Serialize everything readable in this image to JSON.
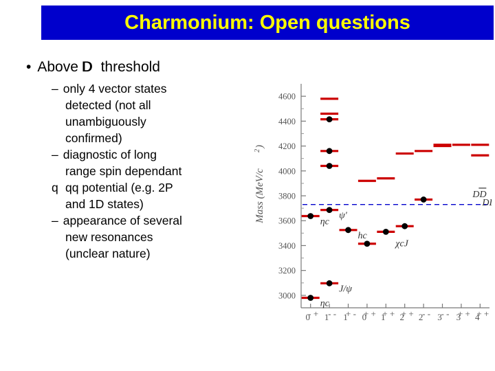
{
  "slide": {
    "title": "Charmonium: Open questions",
    "title_bg": "#0000CC",
    "title_color": "#FFFF00"
  },
  "content": {
    "bullet_glyph": "•",
    "dash_glyph": "–",
    "level1": {
      "text_before": "Above D",
      "overbar_text": "D",
      "text_after": "threshold"
    },
    "level2": [
      {
        "lines": [
          "only 4 vector states",
          "detected (not all",
          "unambiguously",
          "confirmed)"
        ]
      },
      {
        "lines": [
          "diagnostic of long",
          "range spin dependant",
          "qq potential (e.g. 2P",
          "and 1D states)"
        ],
        "overbar_line": 2,
        "overbar_prefix": "q"
      },
      {
        "lines": [
          "appearance of several",
          "new resonances",
          "(unclear nature)"
        ]
      }
    ]
  },
  "chart_data": {
    "type": "scatter",
    "title": "",
    "ylabel": "Mass  (MeV/c2)",
    "ylabel_plain": "Mass  (MeV/c",
    "ylabel_sup": "2",
    "ylabel_close": ")",
    "xlabel": "",
    "ylim": [
      2900,
      4700
    ],
    "yticks": [
      3000,
      3200,
      3400,
      3600,
      3800,
      4000,
      4200,
      4400,
      4600
    ],
    "xticks": [
      "0",
      "1",
      "1",
      "0",
      "1",
      "2",
      "2",
      "3",
      "3",
      "4"
    ],
    "xtick_sup": [
      "- +",
      "- -",
      "+ -",
      "+ +",
      "+ +",
      "+ +",
      "- -",
      "- -",
      "+ +",
      "+ +"
    ],
    "grid": false,
    "threshold_line": {
      "value": 3730,
      "label": "DD",
      "style": "dashed",
      "color": "#0000CC"
    },
    "legend": [],
    "marker_color": "#000000",
    "level_color": "#CC0000",
    "series": [
      {
        "name": "eta_c",
        "label": "ηc",
        "column": 0,
        "points": [
          2980,
          3637
        ],
        "levels": []
      },
      {
        "name": "psi",
        "label": "ψ'",
        "column": 1,
        "points": [
          3097,
          3686,
          4040,
          4160,
          4415
        ],
        "levels": [
          4460,
          4580
        ]
      },
      {
        "name": "h_c",
        "label": "hc",
        "column": 2,
        "points": [
          3525
        ],
        "levels": []
      },
      {
        "name": "chi_c0",
        "label": "",
        "column": 3,
        "points": [
          3415
        ],
        "levels": [
          3920
        ]
      },
      {
        "name": "chi_c1",
        "label": "",
        "column": 4,
        "points": [
          3511
        ],
        "levels": [
          3940
        ]
      },
      {
        "name": "chi_c2",
        "label": "χcJ",
        "column": 5,
        "points": [
          3556
        ],
        "levels": [
          4140
        ]
      },
      {
        "name": "psi_3770",
        "label": "",
        "column": 6,
        "points": [
          3770
        ],
        "levels": [
          4160
        ]
      },
      {
        "name": "D-wave",
        "label": "",
        "column": 7,
        "points": [],
        "levels": [
          4210,
          4200
        ]
      },
      {
        "name": "F-wave",
        "label": "",
        "column": 8,
        "points": [],
        "levels": [
          4210
        ]
      },
      {
        "name": "G-wave",
        "label": "",
        "column": 9,
        "points": [],
        "levels": [
          4210,
          4125
        ]
      }
    ],
    "annotations": [
      {
        "text": "ηc",
        "x": 0,
        "y": 2980
      },
      {
        "text": "ηc",
        "x": 0,
        "y": 3637
      },
      {
        "text": "J/ψ",
        "x": 1,
        "y": 3097
      },
      {
        "text": "ψ'",
        "x": 1,
        "y": 3686
      },
      {
        "text": "hc",
        "x": 2,
        "y": 3525
      },
      {
        "text": "χcJ",
        "x": 4,
        "y": 3460
      },
      {
        "text": "DD",
        "x": 8.6,
        "y": 3790
      }
    ]
  }
}
